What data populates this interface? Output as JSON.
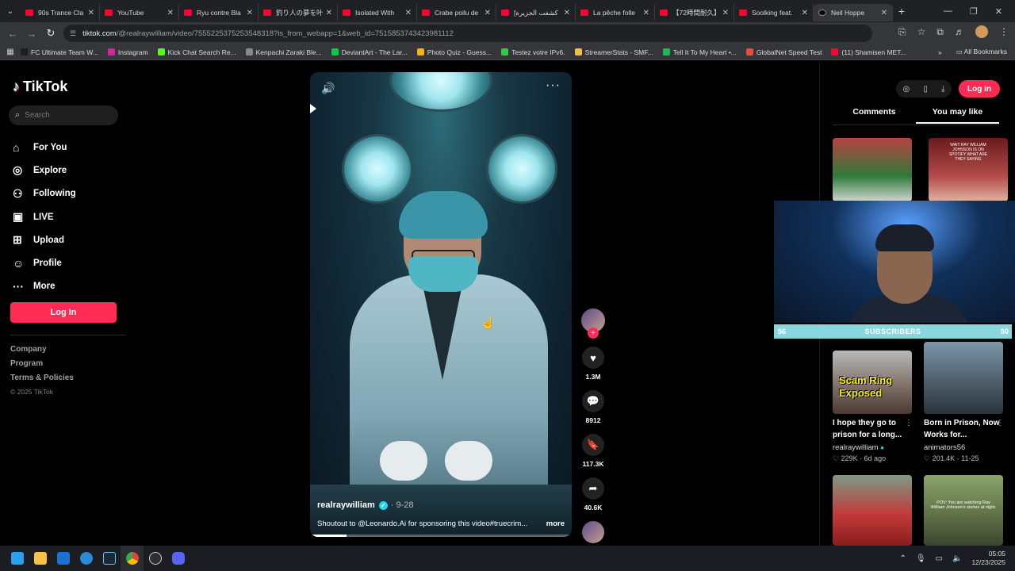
{
  "browser": {
    "tabs": [
      {
        "title": "90s Trance Cla"
      },
      {
        "title": "YouTube"
      },
      {
        "title": "Ryu contre Bla"
      },
      {
        "title": "釣り人の夢を叶"
      },
      {
        "title": "Isolated With"
      },
      {
        "title": "Crabe poilu de"
      },
      {
        "title": "[كشفت الجزيرة"
      },
      {
        "title": "La pêche folle"
      },
      {
        "title": "【72時間耐久】"
      },
      {
        "title": "Soolking feat."
      },
      {
        "title": "Neil Hoppe"
      }
    ],
    "url_host": "tiktok.com",
    "url_path": "/@realraywilliam/video/7555225375253548318?is_from_webapp=1&web_id=7515853743423981112",
    "bookmarks": [
      {
        "label": "FC Ultimate Team W...",
        "color": "#1e1e1e"
      },
      {
        "label": "Instagram",
        "color": "#d6249f"
      },
      {
        "label": "Kick Chat Search Re...",
        "color": "#53fc18"
      },
      {
        "label": "Kenpachi Zaraki Ble...",
        "color": "#888888"
      },
      {
        "label": "DeviantArt - The Lar...",
        "color": "#05cc47"
      },
      {
        "label": "Photo Quiz - Guess...",
        "color": "#f4b400"
      },
      {
        "label": "Testez votre IPv6.",
        "color": "#2ecc40"
      },
      {
        "label": "StreamerStats - SMF...",
        "color": "#f0c040"
      },
      {
        "label": "Tell It To My Heart •...",
        "color": "#1db954"
      },
      {
        "label": "GlobalNet Speed Test",
        "color": "#e74c3c"
      },
      {
        "label": "(11) Shamisen MET...",
        "color": "#ff0033"
      }
    ],
    "all_bookmarks": "All Bookmarks"
  },
  "tiktok": {
    "brand": "TikTok",
    "search_placeholder": "Search",
    "nav": [
      {
        "label": "For You",
        "icon": "home-icon",
        "glyph": "⌂"
      },
      {
        "label": "Explore",
        "icon": "compass-icon",
        "glyph": "◎"
      },
      {
        "label": "Following",
        "icon": "following-icon",
        "glyph": "⚇"
      },
      {
        "label": "LIVE",
        "icon": "live-icon",
        "glyph": "▣"
      },
      {
        "label": "Upload",
        "icon": "upload-icon",
        "glyph": "⊞"
      },
      {
        "label": "Profile",
        "icon": "profile-icon",
        "glyph": "☺"
      },
      {
        "label": "More",
        "icon": "more-icon",
        "glyph": "···"
      }
    ],
    "login_label": "Log In",
    "footer": {
      "company": "Company",
      "program": "Program",
      "terms": "Terms & Policies",
      "copyright": "© 2025 TikTok"
    }
  },
  "video": {
    "author": "realraywilliam",
    "date": "9-28",
    "caption": "Shoutout to @Leonardo.Ai for sponsoring this video#truecrim...",
    "more": "more",
    "progress": 0.14,
    "likes": "1.3M",
    "comments": "8912",
    "saves": "117.3K",
    "shares": "40.6K"
  },
  "right_panel": {
    "login_label": "Log in",
    "tab_comments": "Comments",
    "tab_you_may_like": "You may like",
    "thumb2_text": "WAIT RAY WILLIAM JOHNSON IS ON SPOTIFY WHAT ARE THEY SAYING",
    "cards": [
      {
        "thumb_text": "Scam Ring Exposed",
        "title": "I hope they go to prison for a long...",
        "author": "realraywilliam",
        "likes": "229K",
        "date": "6d ago"
      },
      {
        "thumb_text": "",
        "title": "Born in Prison, Now Works for...",
        "author": "animators56",
        "likes": "201.4K",
        "date": "11-25"
      }
    ],
    "thumb4_text": "POV: You are watching Ray William Johnson's stories at night."
  },
  "stream_overlay": {
    "left_num": "56",
    "label": "SUBSCRIBERS",
    "right_num": "50"
  },
  "taskbar": {
    "time": "05:05",
    "date": "12/23/2025"
  }
}
